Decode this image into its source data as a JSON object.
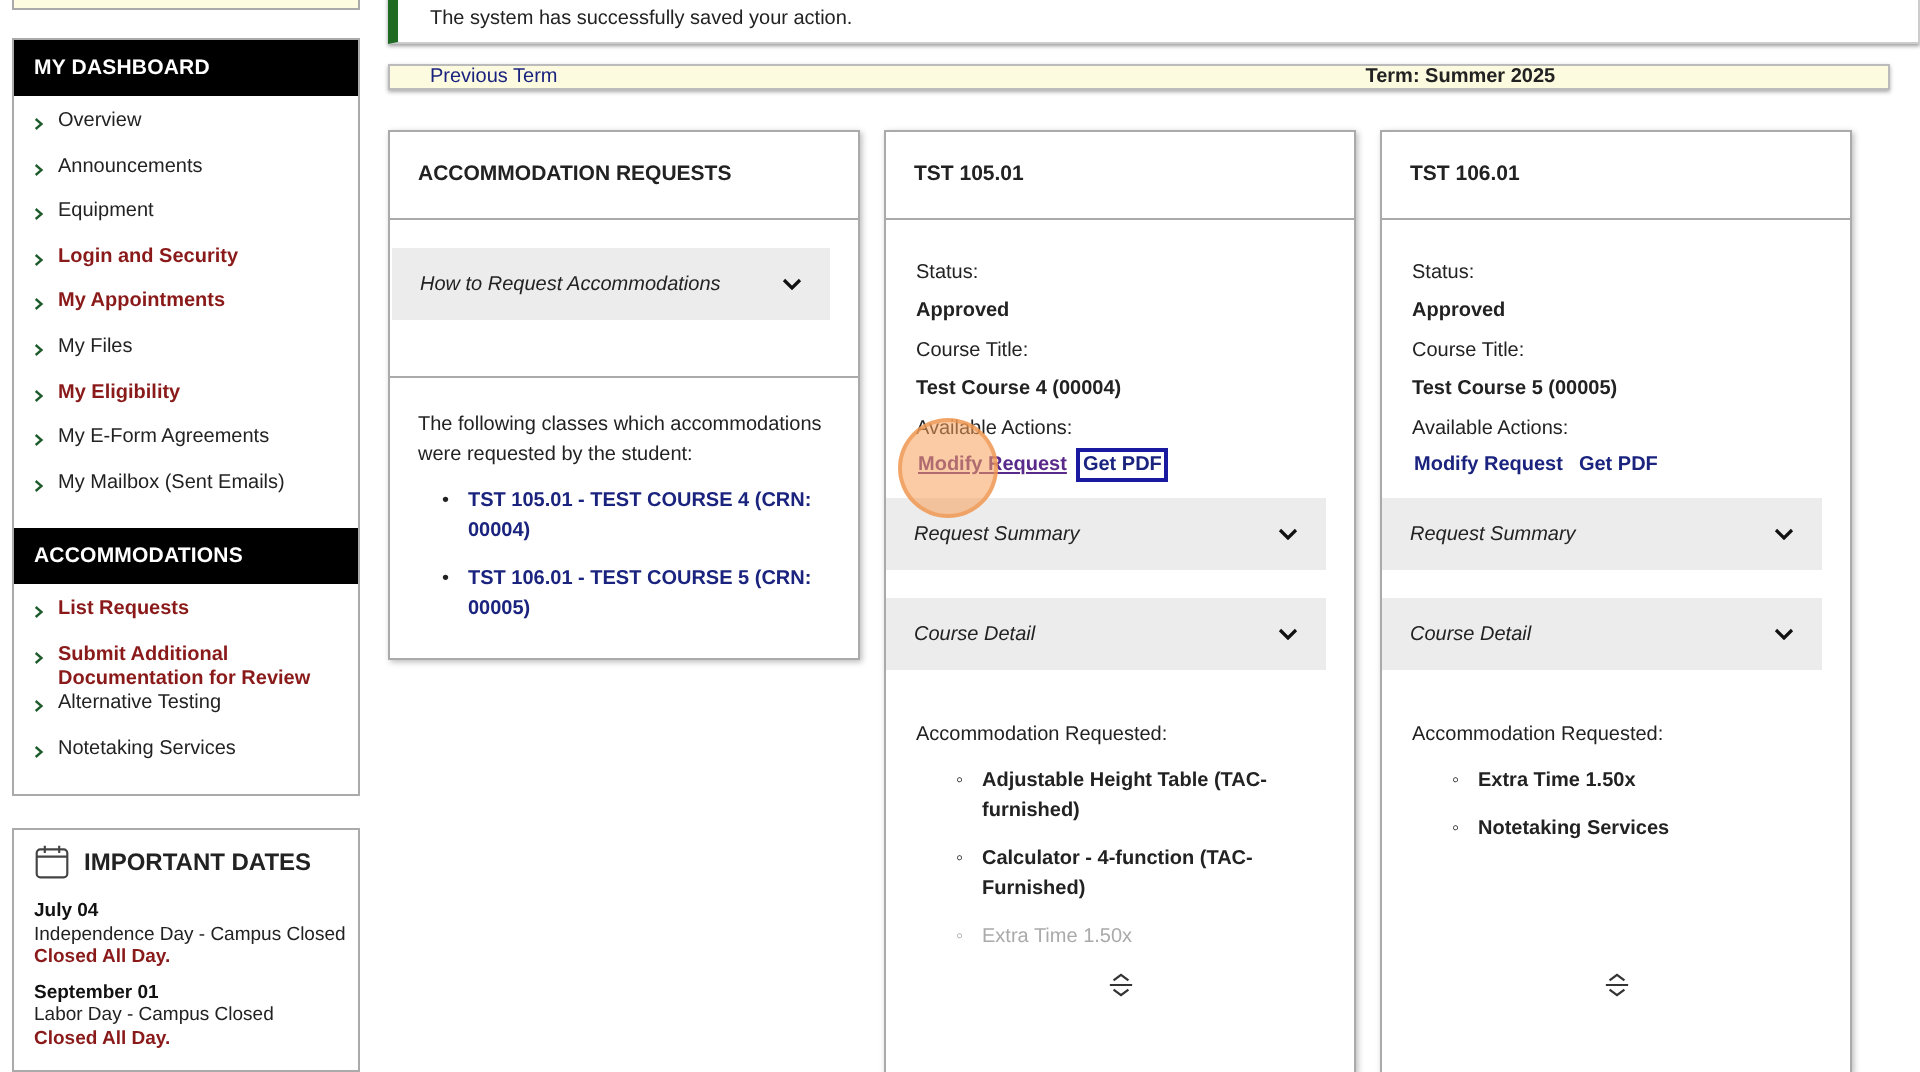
{
  "sidebar": {
    "sections": [
      {
        "title": "MY DASHBOARD",
        "items": [
          {
            "label": "Overview",
            "emphasized": false
          },
          {
            "label": "Announcements",
            "emphasized": false
          },
          {
            "label": "Equipment",
            "emphasized": false
          },
          {
            "label": "Login and Security",
            "emphasized": true
          },
          {
            "label": "My Appointments",
            "emphasized": true
          },
          {
            "label": "My Files",
            "emphasized": false
          },
          {
            "label": "My Eligibility",
            "emphasized": true
          },
          {
            "label": "My E-Form Agreements",
            "emphasized": false
          },
          {
            "label": "My Mailbox (Sent Emails)",
            "emphasized": false
          }
        ]
      },
      {
        "title": "ACCOMMODATIONS",
        "items": [
          {
            "label": "List Requests",
            "emphasized": true
          },
          {
            "label": "Submit Additional Documentation for Review",
            "emphasized": true
          },
          {
            "label": "Alternative Testing",
            "emphasized": false
          },
          {
            "label": "Notetaking Services",
            "emphasized": false
          }
        ]
      }
    ],
    "important_dates": {
      "title": "IMPORTANT DATES",
      "entries": [
        {
          "date": "July 04",
          "name": "Independence Day - Campus Closed",
          "note": "Closed All Day."
        },
        {
          "date": "September 01",
          "name": "Labor Day - Campus Closed",
          "note": "Closed All Day."
        }
      ]
    }
  },
  "success_message": "The system has successfully saved your action.",
  "term_bar": {
    "previous_link": "Previous Term",
    "term": "Term: Summer 2025"
  },
  "requests_panel": {
    "title": "ACCOMMODATION REQUESTS",
    "accordion": {
      "label": "How to Request Accommodations",
      "expanded": false
    },
    "intro": "The following classes which accommodations were requested by the student:",
    "bullet": "•",
    "links": [
      "TST 105.01 - TEST COURSE 4 (CRN: 00004)",
      "TST 106.01 - TEST COURSE 5 (CRN: 00005)"
    ]
  },
  "course_cards": [
    {
      "title": "TST 105.01",
      "status_label": "Status:",
      "status": "Approved",
      "course_title_label": "Course Title:",
      "course_title": "Test Course 4 (00004)",
      "actions_label": "Available Actions:",
      "actions": [
        {
          "label": "Modify Request",
          "visited": true,
          "focused": false,
          "clicked": true
        },
        {
          "label": "Get PDF",
          "visited": false,
          "focused": true,
          "clicked": false
        }
      ],
      "sections": [
        {
          "label": "Request Summary",
          "expanded": false
        },
        {
          "label": "Course Detail",
          "expanded": false
        }
      ],
      "accommodations_label": "Accommodation Requested:",
      "bullet": "◦",
      "accommodations": [
        {
          "label": "Adjustable Height Table (TAC-furnished)",
          "faded": false
        },
        {
          "label": "Calculator - 4-function (TAC-Furnished)",
          "faded": false
        },
        {
          "label": "Extra Time 1.50x",
          "faded": true
        }
      ]
    },
    {
      "title": "TST 106.01",
      "status_label": "Status:",
      "status": "Approved",
      "course_title_label": "Course Title:",
      "course_title": "Test Course 5 (00005)",
      "actions_label": "Available Actions:",
      "actions": [
        {
          "label": "Modify Request",
          "visited": false,
          "focused": false,
          "clicked": false
        },
        {
          "label": "Get PDF",
          "visited": false,
          "focused": false,
          "clicked": false
        }
      ],
      "sections": [
        {
          "label": "Request Summary",
          "expanded": false
        },
        {
          "label": "Course Detail",
          "expanded": false
        }
      ],
      "accommodations_label": "Accommodation Requested:",
      "bullet": "◦",
      "accommodations": [
        {
          "label": "Extra Time 1.50x",
          "faded": false
        },
        {
          "label": "Notetaking Services",
          "faded": false
        }
      ]
    }
  ]
}
